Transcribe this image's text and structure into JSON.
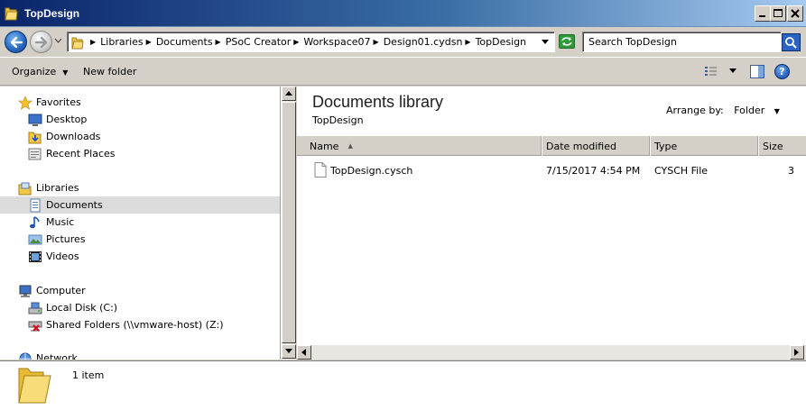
{
  "window": {
    "title": "TopDesign"
  },
  "address": {
    "crumbs": [
      "Libraries",
      "Documents",
      "PSoC Creator",
      "Workspace07",
      "Design01.cydsn",
      "TopDesign"
    ],
    "search_placeholder": "Search TopDesign"
  },
  "toolbar": {
    "organize_label": "Organize",
    "new_folder_label": "New folder"
  },
  "nav": {
    "favorites": {
      "label": "Favorites",
      "items": [
        "Desktop",
        "Downloads",
        "Recent Places"
      ]
    },
    "libraries": {
      "label": "Libraries",
      "items": [
        "Documents",
        "Music",
        "Pictures",
        "Videos"
      ]
    },
    "computer": {
      "label": "Computer",
      "items": [
        "Local Disk (C:)",
        "Shared Folders (\\\\vmware-host) (Z:)"
      ]
    },
    "network": {
      "label": "Network"
    },
    "selected": "Documents"
  },
  "content": {
    "library_title": "Documents library",
    "library_subtitle": "TopDesign",
    "arrange_label": "Arrange by:",
    "arrange_value": "Folder",
    "columns": {
      "name": "Name",
      "date": "Date modified",
      "type": "Type",
      "size": "Size"
    },
    "files": [
      {
        "name": "TopDesign.cysch",
        "date": "7/15/2017 4:54 PM",
        "type": "CYSCH File",
        "size": "3"
      }
    ]
  },
  "details": {
    "item_count": "1 item"
  },
  "colors": {
    "title_gradient_start": "#0a246a",
    "title_gradient_end": "#a6caf0",
    "chrome": "#d4d0c8",
    "selection": "#dcdcdc",
    "folder": "#f2c84b"
  }
}
